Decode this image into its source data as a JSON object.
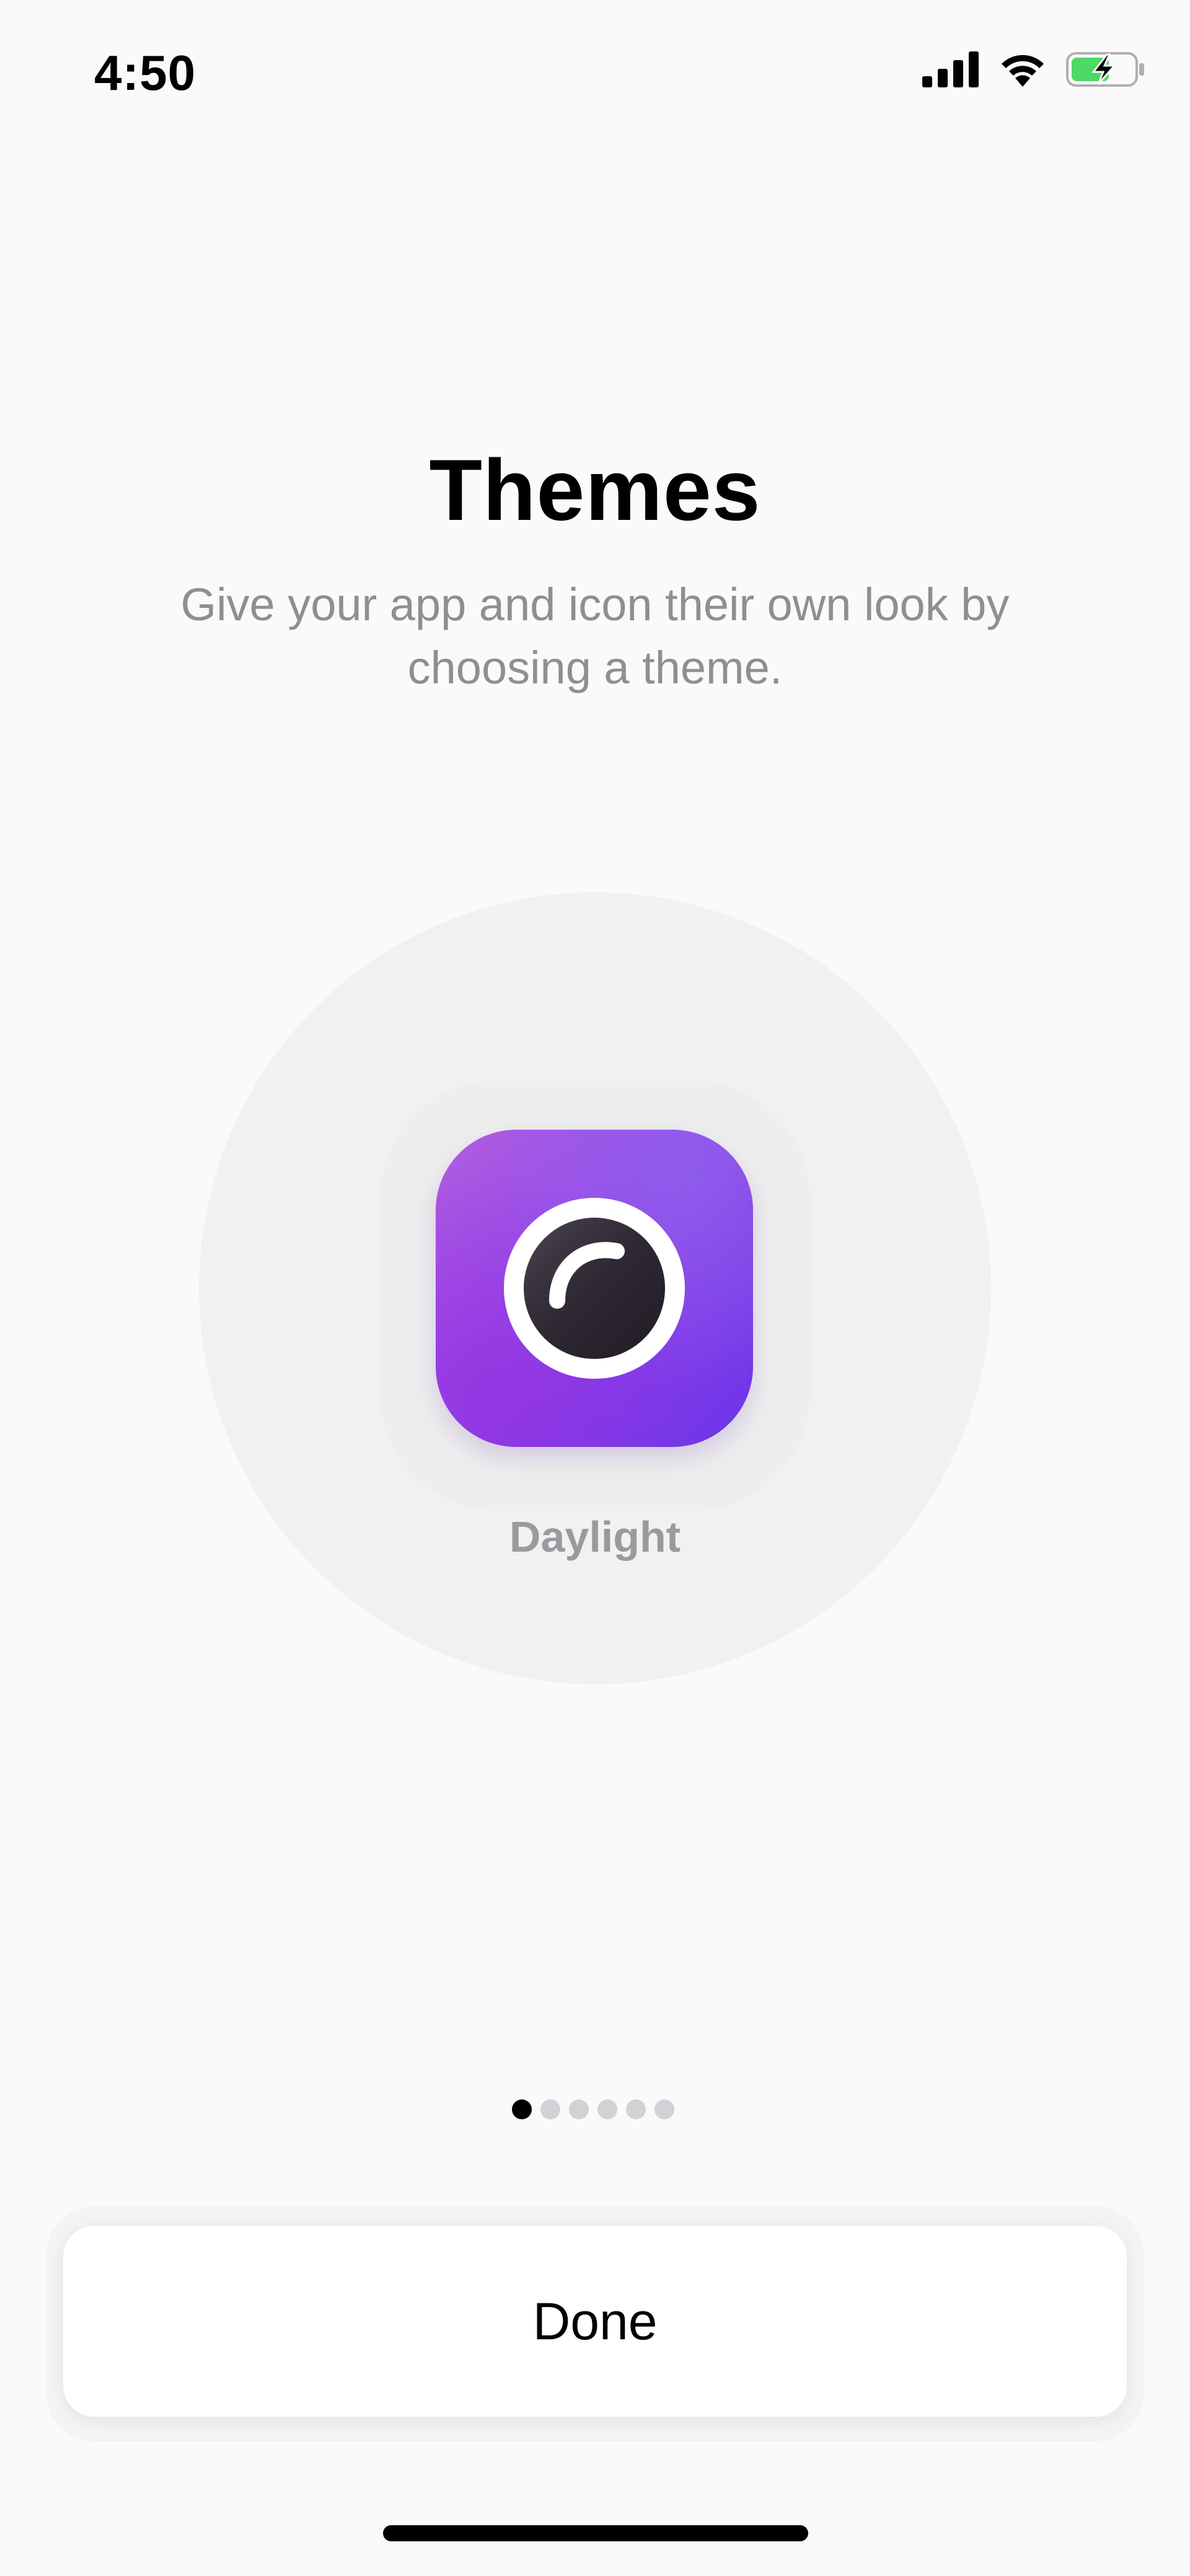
{
  "status_bar": {
    "time": "4:50",
    "icons": [
      "cellular-signal-icon",
      "wifi-icon",
      "battery-charging-icon"
    ],
    "battery_color": "#4cd964"
  },
  "header": {
    "title": "Themes",
    "subtitle": "Give your app and icon their own look by choosing a theme."
  },
  "theme_preview": {
    "icon": "camera-lens-icon",
    "name": "Daylight",
    "icon_gradient": [
      "#b15ee0",
      "#8a3fe8",
      "#6a34e8"
    ]
  },
  "pager": {
    "total": 6,
    "current": 1
  },
  "footer": {
    "done_label": "Done"
  }
}
